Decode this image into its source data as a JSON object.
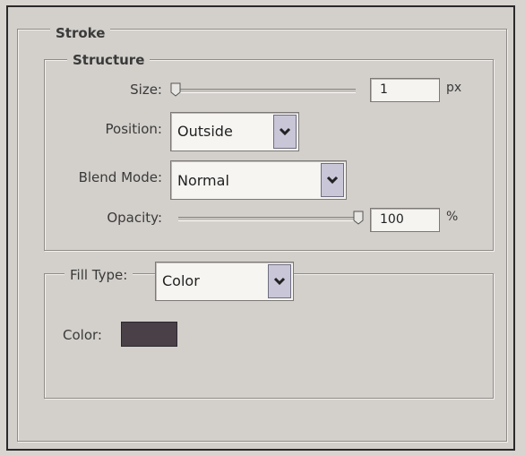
{
  "stroke": {
    "title": "Stroke",
    "structure": {
      "title": "Structure",
      "size": {
        "label": "Size:",
        "value": "1",
        "unit": "px",
        "level": 0.0
      },
      "position": {
        "label": "Position:",
        "selected": "Outside"
      },
      "blend_mode": {
        "label": "Blend Mode:",
        "selected": "Normal"
      },
      "opacity": {
        "label": "Opacity:",
        "value": "100",
        "unit": "%",
        "level": 1.0
      }
    },
    "fill": {
      "type_label": "Fill Type:",
      "type_selected": "Color",
      "color_label": "Color:",
      "color_value": "#4a4048"
    }
  },
  "icons": {
    "dropdown": "chevron-down-icon",
    "slider": "slider-thumb-icon"
  }
}
